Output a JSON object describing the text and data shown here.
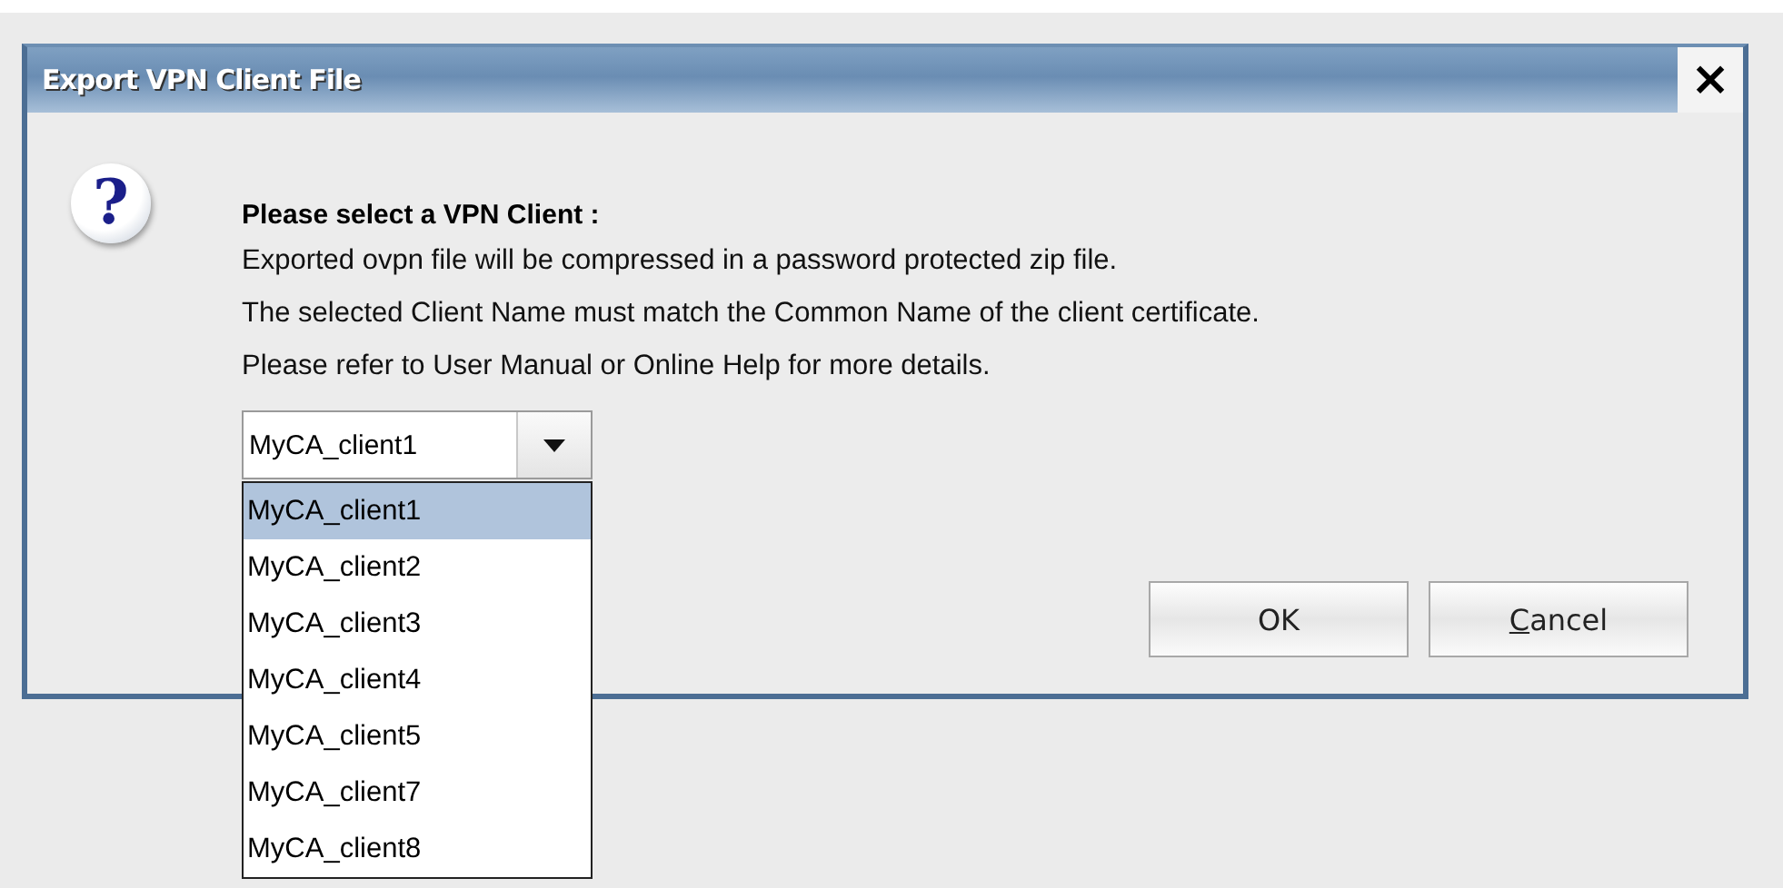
{
  "window": {
    "title": "Export VPN Client File",
    "close": "×"
  },
  "dialog": {
    "icon": "?",
    "heading": "Please select a VPN Client :",
    "lines": [
      "Exported ovpn file will be compressed in a password protected zip file.",
      "The selected Client Name must match the Common Name of the client certificate.",
      "Please refer to User Manual or Online Help for more details."
    ]
  },
  "combo": {
    "value": "MyCA_client1",
    "expanded": true
  },
  "options": [
    {
      "label": "MyCA_client1",
      "selected": true
    },
    {
      "label": "MyCA_client2",
      "selected": false
    },
    {
      "label": "MyCA_client3",
      "selected": false
    },
    {
      "label": "MyCA_client4",
      "selected": false
    },
    {
      "label": "MyCA_client5",
      "selected": false
    },
    {
      "label": "MyCA_client7",
      "selected": false
    },
    {
      "label": "MyCA_client8",
      "selected": false
    }
  ],
  "buttons": [
    {
      "label": "OK",
      "mnemonic_first": false
    },
    {
      "label": "Cancel",
      "mnemonic_first": true
    }
  ]
}
